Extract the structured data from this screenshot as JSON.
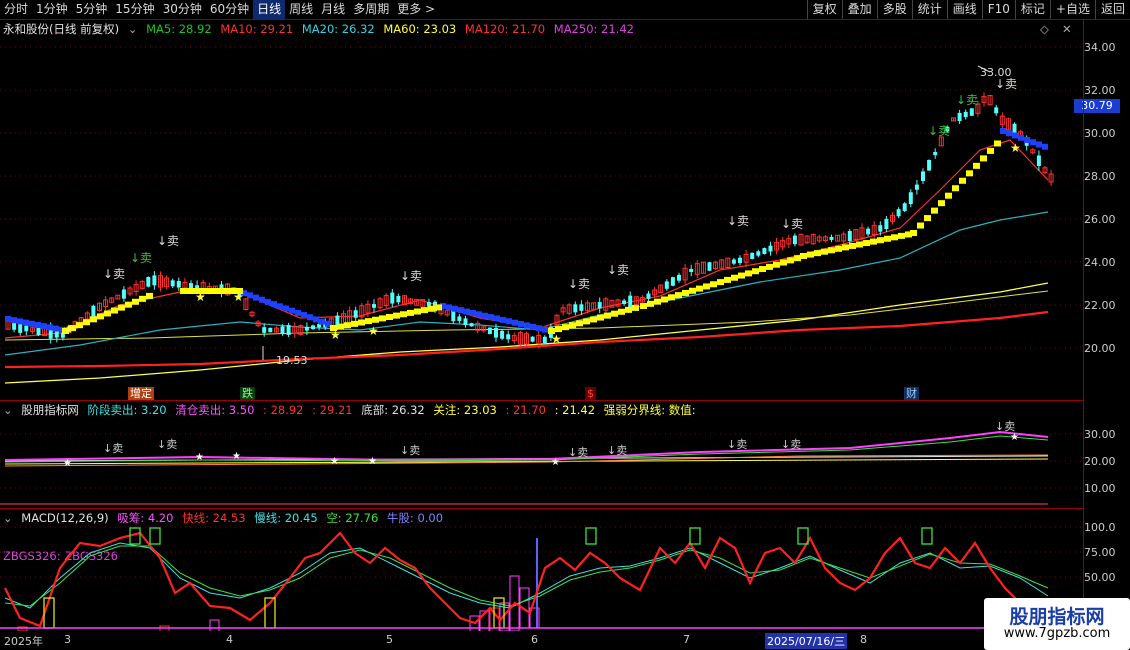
{
  "toolbar": {
    "left_items": [
      "分时",
      "1分钟",
      "5分钟",
      "15分钟",
      "30分钟",
      "60分钟",
      "日线",
      "周线",
      "月线",
      "多周期",
      "更多 >"
    ],
    "active": "日线",
    "right_items": [
      "复权",
      "叠加",
      "多股",
      "统计",
      "画线",
      "F10",
      "标记",
      "+自选",
      "返回"
    ]
  },
  "main_legend": {
    "stock": "永和股份(日线 前复权)",
    "ma5": "MA5: 28.92",
    "ma10": "MA10: 29.21",
    "ma20": "MA20: 26.32",
    "ma60": "MA60: 23.03",
    "ma120": "MA120: 21.70",
    "ma250": "MA250: 21.42"
  },
  "main_axis": [
    "34.00",
    "32.00",
    "30.00",
    "28.00",
    "26.00",
    "24.00",
    "22.00",
    "20.00"
  ],
  "current_price": "30.79",
  "annotations": {
    "high": "33.00",
    "low": "19.53",
    "sell": "↓卖"
  },
  "event_tags": {
    "t1": "增定",
    "t2": "跌",
    "t3": "$",
    "t4": "财"
  },
  "ind_legend": {
    "name": "股朋指标网",
    "a": "阶段卖出: 3.20",
    "b": "清仓卖出: 3.50",
    "c": ": 28.92",
    "d": ": 29.21",
    "e": "底部: 26.32",
    "f": "关注: 23.03",
    "g": ": 21.70",
    "h": ": 21.42",
    "i": "强弱分界线: 数值:"
  },
  "ind_axis": [
    "30.00",
    "20.00",
    "10.00"
  ],
  "macd_legend": {
    "name": "MACD(12,26,9)",
    "a": "吸筹: 4.20",
    "b": "快线: 24.53",
    "c": "慢线: 20.45",
    "d": "空: 27.76",
    "e": "牛股: 0.00",
    "zbgs": "ZBGS326: ZBGS326"
  },
  "macd_axis": [
    "100.0",
    "75.00",
    "50.00"
  ],
  "dates": {
    "d0": "2025年",
    "d3": "3",
    "d4": "4",
    "d5": "5",
    "d6": "6",
    "d7": "7",
    "dsel": "2025/07/16/三",
    "d8": "8"
  },
  "watermark": {
    "line1": "股朋指标网",
    "line2": "www.7gpzb.com"
  },
  "colors": {
    "up": "#ff3030",
    "down": "#54ffff",
    "ma5": "#ffffff",
    "ma20": "#2ab0c0",
    "ma60": "#e8e020",
    "ma120": "#ff2020",
    "accent": "#1a3cd0"
  }
}
